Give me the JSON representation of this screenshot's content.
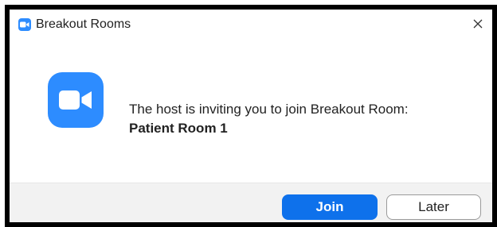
{
  "window": {
    "title": "Breakout Rooms",
    "app_icon": "zoom-camera-icon",
    "close_icon": "close-icon"
  },
  "dialog": {
    "logo_icon": "zoom-camera-icon",
    "message": "The host is inviting you to join Breakout Room:",
    "room_name": "Patient Room 1"
  },
  "buttons": {
    "join_label": "Join",
    "later_label": "Later"
  },
  "colors": {
    "zoom_blue": "#2d8cff",
    "join_button": "#0e71eb",
    "footer_bg": "#f2f2f2"
  }
}
